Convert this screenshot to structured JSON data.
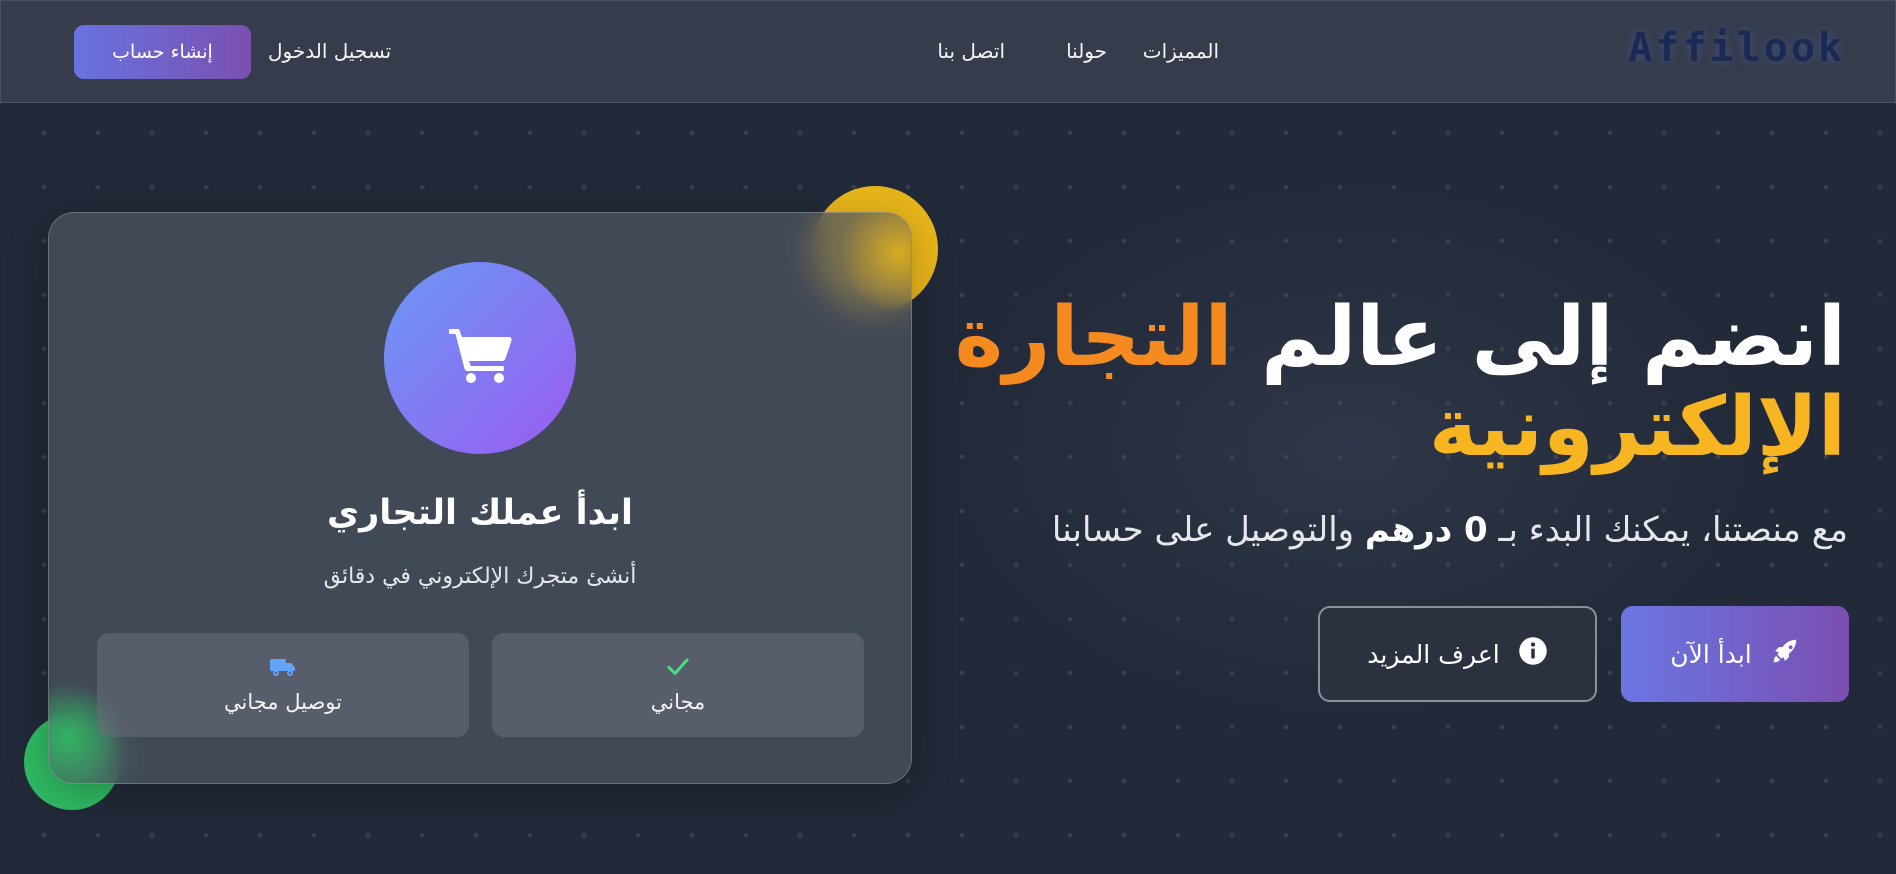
{
  "nav": {
    "logo": "Affilook",
    "links": [
      "المميزات",
      "حولنا",
      "اتصل بنا"
    ],
    "login": "تسجيل الدخول",
    "signup": "إنشاء حساب"
  },
  "hero": {
    "title_white_1": "انضم إلى عالم",
    "title_orange": "التجارة",
    "title_yellow": "الإلكترونية",
    "subtitle_1": "مع منصتنا، يمكنك البدء بـ",
    "subtitle_bold": "0 درهم",
    "subtitle_2": "والتوصيل على حسابنا",
    "primary_button": "ابدأ الآن",
    "primary_icon": "rocket-icon",
    "secondary_button": "اعرف المزيد",
    "secondary_icon": "info-icon"
  },
  "card": {
    "icon": "shopping-cart-icon",
    "title": "ابدأ عملك التجاري",
    "subtitle": "أنشئ متجرك الإلكتروني في دقائق",
    "features": [
      {
        "label": "مجاني",
        "icon": "check-icon",
        "icon_color": "#4ade80"
      },
      {
        "label": "توصيل مجاني",
        "icon": "delivery-truck-icon",
        "icon_color": "#60a5fa"
      }
    ]
  },
  "colors": {
    "accent_orange": "#f58a1f",
    "accent_yellow": "#f7b522",
    "button_gradient_start": "#6b76e3",
    "button_gradient_end": "#7a4fb2"
  }
}
